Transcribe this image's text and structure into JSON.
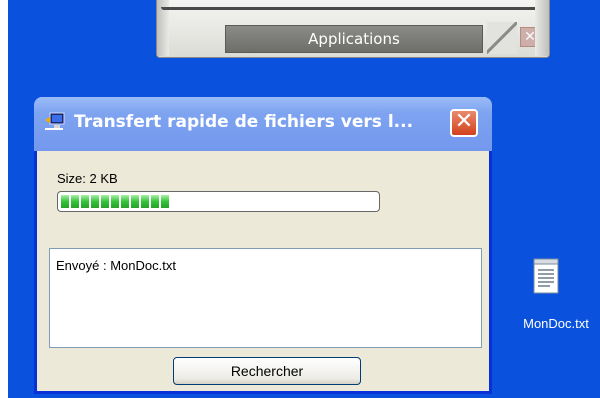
{
  "taskbar": {
    "applications_label": "Applications"
  },
  "window": {
    "title": "Transfert rapide de fichiers vers l...",
    "close_symbol": "✕",
    "size_label": "Size: 2 KB",
    "progress": {
      "filled_segments": 11,
      "percent": 44
    },
    "log": {
      "lines": [
        "Envoyé : MonDoc.txt"
      ]
    },
    "search_button_label": "Rechercher"
  },
  "desktop": {
    "file": {
      "name": "MonDoc.txt",
      "icon": "text-file-icon"
    },
    "background_color": "#0a52de"
  },
  "colors": {
    "title_bar": "#7398ee",
    "window_border": "#0831d9",
    "close_button": "#d2411c",
    "progress_fill": "#35c43a"
  }
}
